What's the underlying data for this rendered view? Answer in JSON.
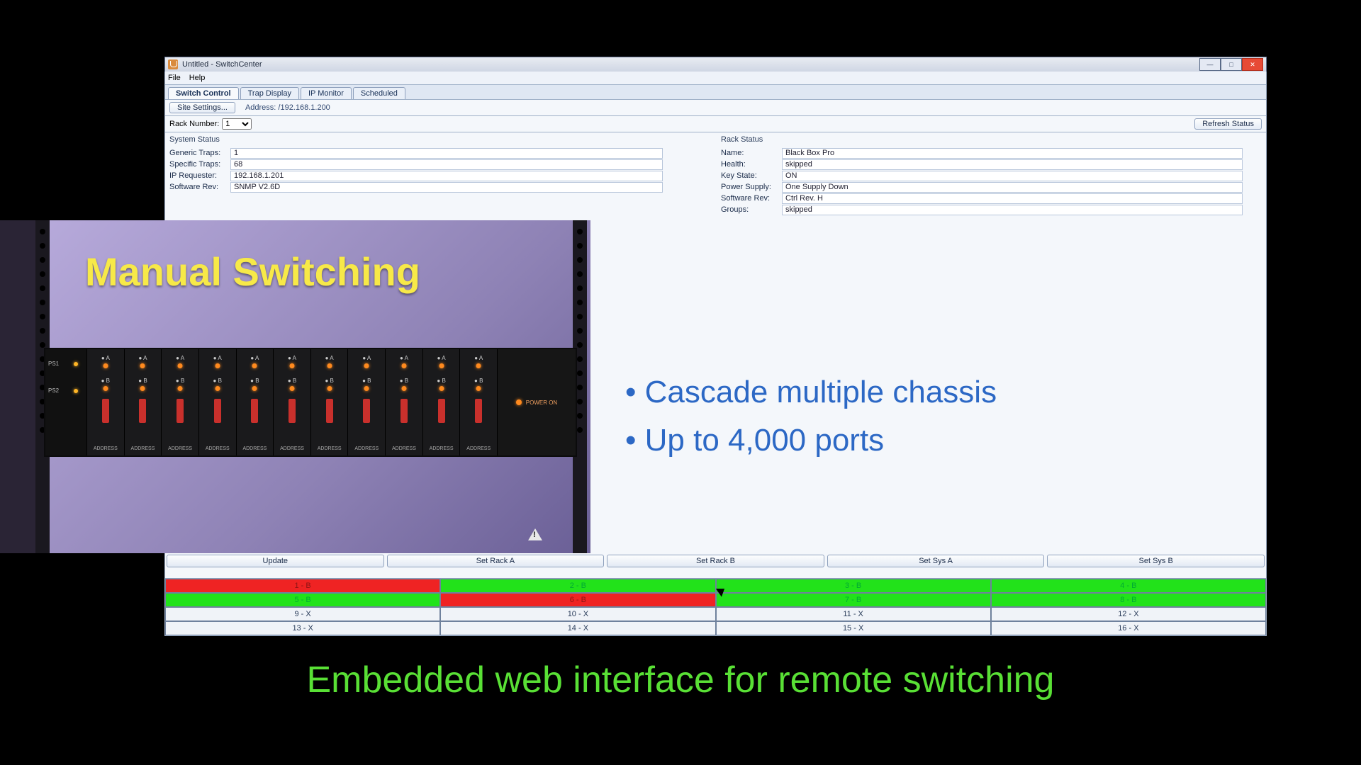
{
  "window": {
    "title": "Untitled - SwitchCenter",
    "menu": {
      "file": "File",
      "help": "Help"
    },
    "tabs": [
      "Switch Control",
      "Trap Display",
      "IP Monitor",
      "Scheduled"
    ],
    "active_tab_index": 0,
    "site_settings_btn": "Site Settings...",
    "address_label": "Address: /192.168.1.200",
    "rack_number_label": "Rack Number:",
    "rack_number_value": "1",
    "refresh_btn": "Refresh Status"
  },
  "system_status": {
    "title": "System Status",
    "rows": [
      {
        "k": "Generic Traps:",
        "v": "1"
      },
      {
        "k": "Specific Traps:",
        "v": "68"
      },
      {
        "k": "IP Requester:",
        "v": "192.168.1.201"
      },
      {
        "k": "Software Rev:",
        "v": "SNMP V2.6D"
      }
    ]
  },
  "rack_status": {
    "title": "Rack Status",
    "rows": [
      {
        "k": "Name:",
        "v": "Black Box Pro"
      },
      {
        "k": "Health:",
        "v": "skipped"
      },
      {
        "k": "Key State:",
        "v": "ON"
      },
      {
        "k": "Power Supply:",
        "v": "One Supply Down"
      },
      {
        "k": "Software Rev:",
        "v": "Ctrl Rev. H"
      },
      {
        "k": "Groups:",
        "v": "skipped"
      }
    ]
  },
  "action_buttons": [
    "Update",
    "Set Rack A",
    "Set Rack B",
    "Set Sys A",
    "Set Sys B"
  ],
  "port_grid": [
    [
      {
        "t": "1 - B",
        "c": "red"
      },
      {
        "t": "2 - B",
        "c": "green"
      },
      {
        "t": "3 - B",
        "c": "green"
      },
      {
        "t": "4 - B",
        "c": "green"
      }
    ],
    [
      {
        "t": "5 - B",
        "c": "green"
      },
      {
        "t": "6 - B",
        "c": "red"
      },
      {
        "t": "7 - B",
        "c": "green"
      },
      {
        "t": "8 - B",
        "c": "green"
      }
    ],
    [
      {
        "t": "9 - X",
        "c": "gray"
      },
      {
        "t": "10 - X",
        "c": "gray"
      },
      {
        "t": "11 - X",
        "c": "gray"
      },
      {
        "t": "12 - X",
        "c": "gray"
      }
    ],
    [
      {
        "t": "13 - X",
        "c": "gray"
      },
      {
        "t": "14 - X",
        "c": "gray"
      },
      {
        "t": "15 - X",
        "c": "gray"
      },
      {
        "t": "16 - X",
        "c": "gray"
      }
    ]
  ],
  "slide": {
    "photo_title": "Manual Switching",
    "bullets": [
      "Cascade multiple chassis",
      "Up to 4,000 ports"
    ],
    "caption": "Embedded web interface for remote switching",
    "chassis": {
      "psu_labels": [
        "PS1",
        "PS2"
      ],
      "slot_count": 11,
      "slot_addr_label": "ADDRESS",
      "power_label": "POWER ON"
    }
  }
}
